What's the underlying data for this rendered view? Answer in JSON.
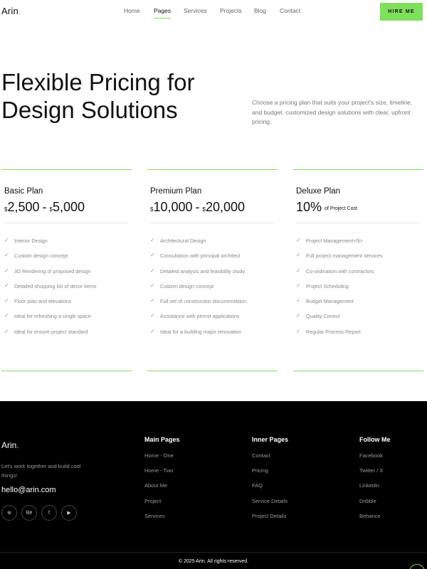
{
  "header": {
    "logo": "Arin",
    "logo_dot": ".",
    "nav": [
      "Home",
      "Pages",
      "Services",
      "Projects",
      "Blog",
      "Contact"
    ],
    "active_nav": "Pages",
    "hire_label": "HIRE ME"
  },
  "hero": {
    "title": "Flexible Pricing for Design Solutions",
    "description": "Choose a pricing plan that suits your project's size, timeline, and budget. customized design solutions with clear, upfront pricing."
  },
  "plans": [
    {
      "name": "Basic Plan",
      "currency": "$",
      "price_from": "2,500",
      "price_to": "5,000",
      "features": [
        "Interior Design",
        "Custom design concept",
        "3D Rendering of proposed design",
        "Detailed shopping list of decor items",
        "Floor plan and elevations",
        "Ideal for refreshing a single space",
        "Ideal for ensure project standard"
      ]
    },
    {
      "name": "Premium Plan",
      "currency": "$",
      "price_from": "10,000",
      "price_to": "20,000",
      "features": [
        "Architectural Design",
        "Consultation with principal architect",
        "Detailed analysis and feasibility study",
        "Custom design concept",
        "Full set of construction documentation",
        "Assistance with permit applications",
        "Ideal for a building major renovation"
      ]
    },
    {
      "name": "Deluxe Plan",
      "percent": "10%",
      "percent_suffix": "of Project Cost",
      "features": [
        "Project Management</li>",
        "Full project management services",
        "Co-ordination with contractors",
        "Project Scheduling",
        "Budget Management",
        "Quality Control",
        "Regular Process Report"
      ]
    }
  ],
  "footer": {
    "logo": "Arin",
    "logo_dot": ".",
    "tagline": "Let's work together and build cool things!",
    "email": "hello@arin.com",
    "socials": [
      "dribbble-icon",
      "behance-icon",
      "facebook-icon",
      "youtube-icon"
    ],
    "social_glyphs": [
      "⊛",
      "Bē",
      "f",
      "▶"
    ],
    "columns": [
      {
        "title": "Main Pages",
        "links": [
          "Home - One",
          "Home - Two",
          "About Me",
          "Project",
          "Services"
        ]
      },
      {
        "title": "Inner Pages",
        "links": [
          "Contact",
          "Pricing",
          "FAQ",
          "Service Details",
          "Project Details"
        ]
      },
      {
        "title": "Follow Me",
        "links": [
          "Facebook",
          "Twitter / X",
          "Linkedin",
          "Dribble",
          "Behance"
        ]
      }
    ],
    "copyright": "© 2025 Arin. All rights reserved."
  },
  "colors": {
    "accent": "#7ee05a",
    "footer_bg": "#000000"
  }
}
